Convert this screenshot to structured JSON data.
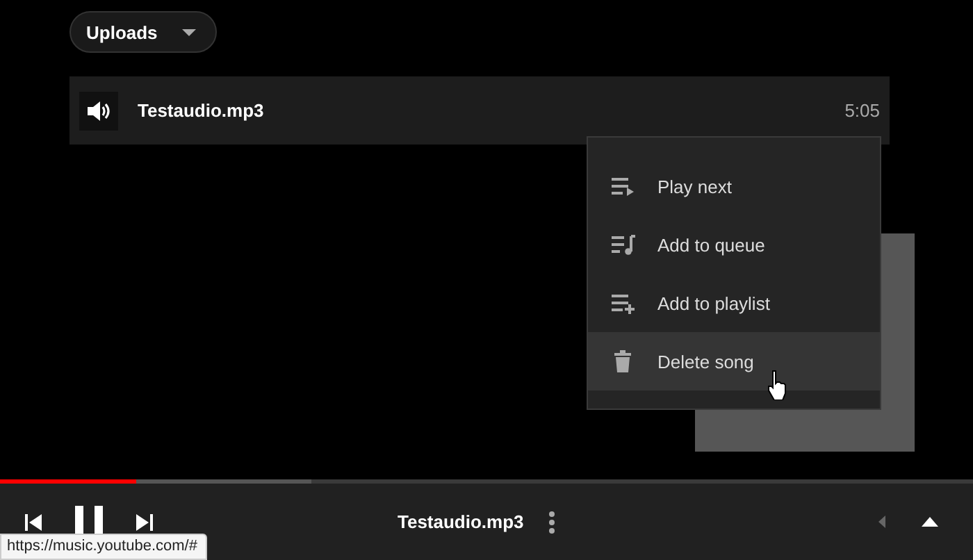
{
  "filter": {
    "label": "Uploads"
  },
  "songs": [
    {
      "title": "Testaudio.mp3",
      "duration": "5:05",
      "playing": true
    }
  ],
  "context_menu": {
    "items": [
      {
        "kind": "play-next",
        "label": "Play next",
        "selected": false
      },
      {
        "kind": "queue",
        "label": "Add to queue",
        "selected": false
      },
      {
        "kind": "playlist",
        "label": "Add to playlist",
        "selected": false
      },
      {
        "kind": "delete",
        "label": "Delete song",
        "selected": true
      }
    ]
  },
  "player": {
    "progress": {
      "level": 0.14
    },
    "buffered": {
      "level": 0.32
    },
    "title": "Testaudio.mp3",
    "playing": true
  },
  "status_bar": {
    "url": "https://music.youtube.com/#"
  }
}
